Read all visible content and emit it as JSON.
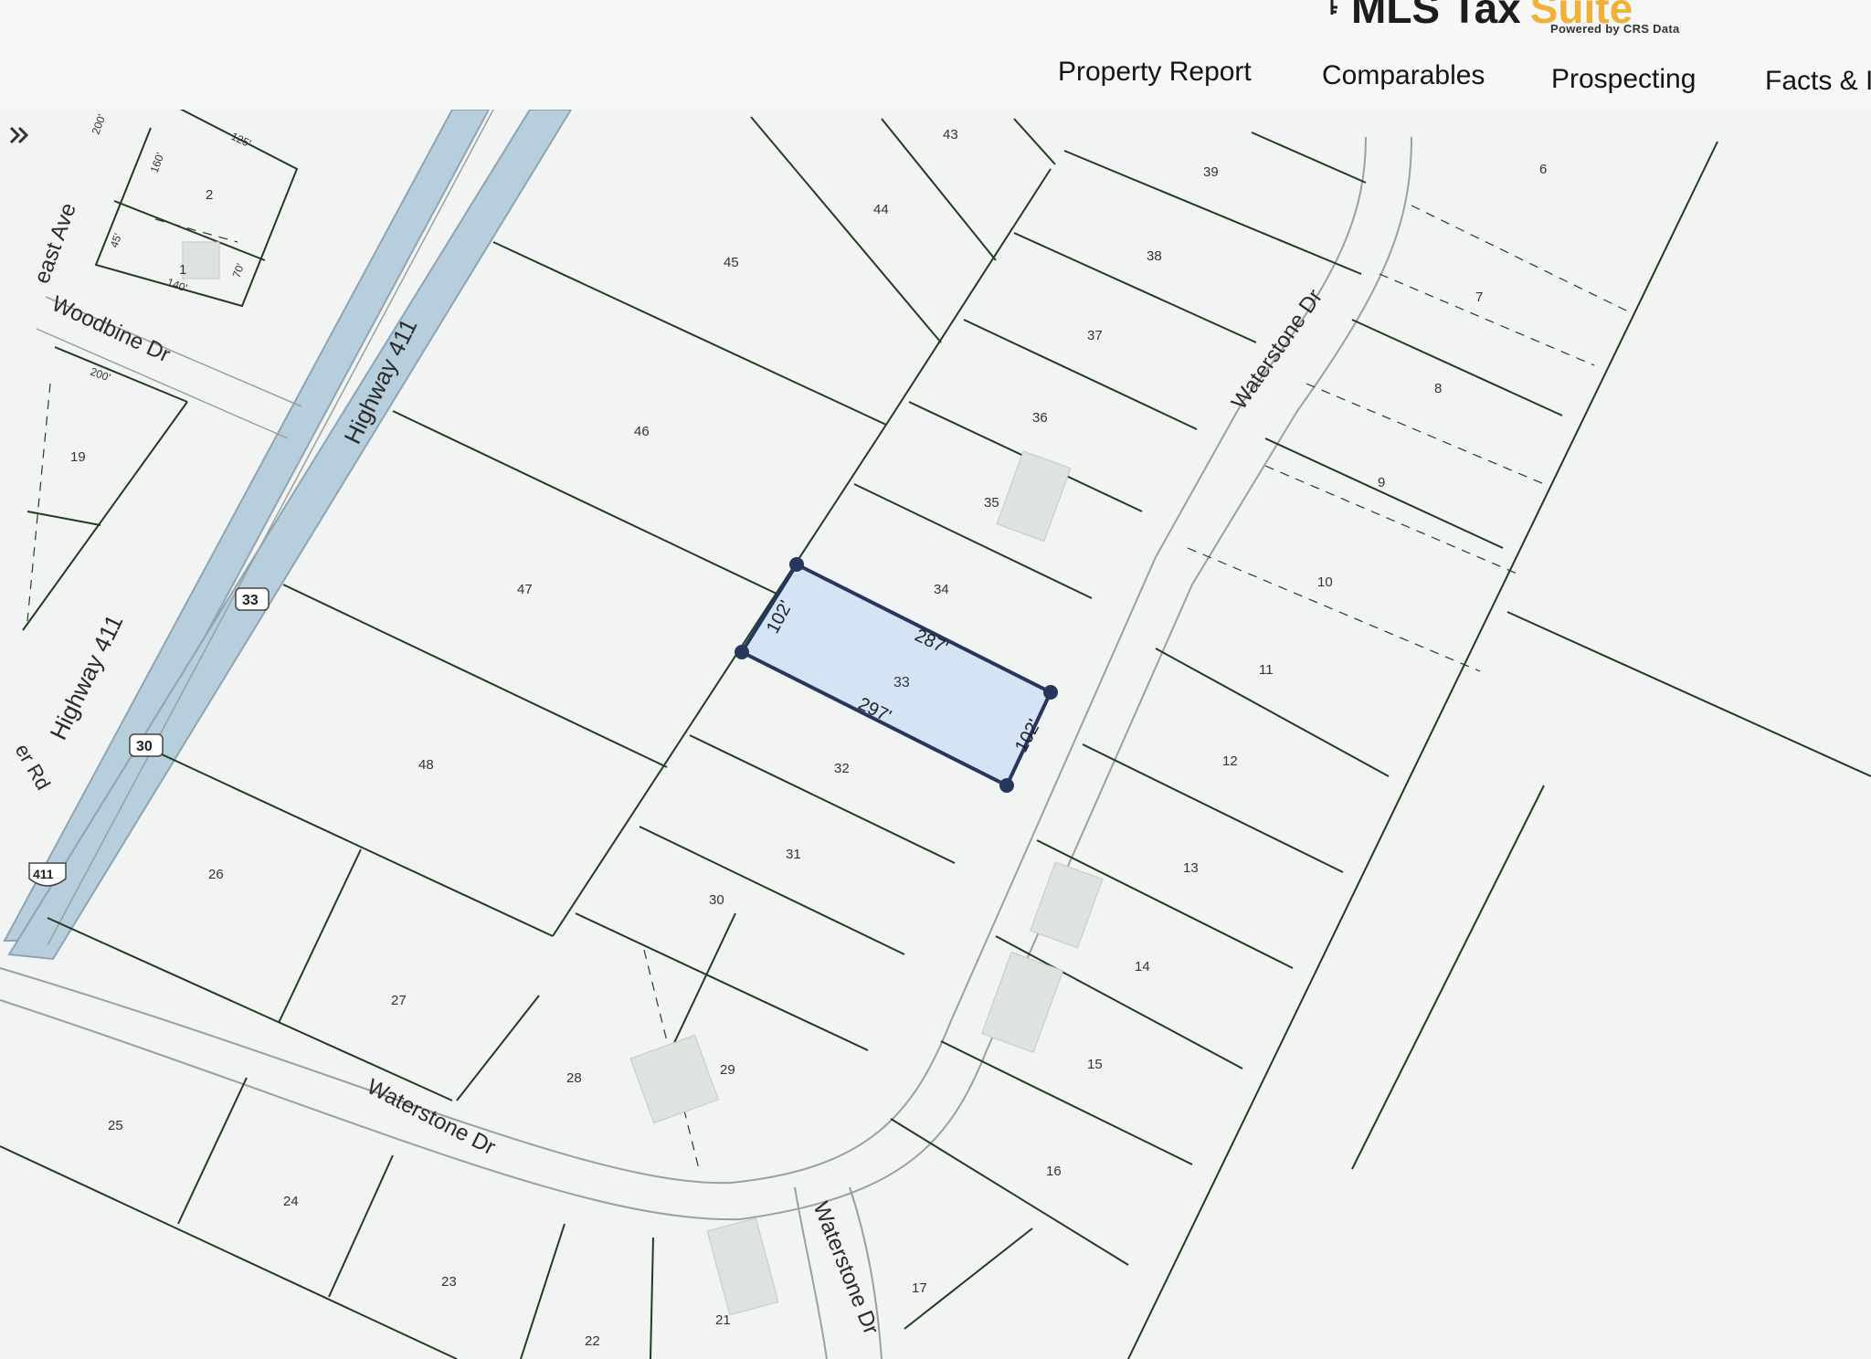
{
  "header": {
    "brand_main": "MLS Tax",
    "brand_accent": "Suite",
    "powered_by": "Powered by CRS Data"
  },
  "nav": {
    "tabs": [
      {
        "label": "Property Report"
      },
      {
        "label": "Comparables"
      },
      {
        "label": "Prospecting"
      },
      {
        "label": "Facts & I"
      }
    ]
  },
  "map": {
    "colors": {
      "lot_line": "#1f3d1f",
      "road_edge": "#9aa19a",
      "highway_fill": "#b7cfdc",
      "selected_fill": "#cfe1f6",
      "selected_stroke": "#27365c",
      "background": "#f1f4f2"
    },
    "streets": {
      "east_ave": "east Ave",
      "woodbine": "Woodbine Dr",
      "highway_upper": "Highway 411",
      "highway_lower": "Highway 411",
      "waterstone_north": "Waterstone Dr",
      "waterstone_west": "Waterstone Dr",
      "waterstone_south": "Waterstone Dr",
      "partial_rd": "er Rd"
    },
    "route_shields": {
      "shield_33": "33",
      "shield_30": "30",
      "shield_411": "411"
    },
    "selected_parcel": {
      "lot": "33",
      "dim_north": "287'",
      "dim_south": "297'",
      "dim_west": "102'",
      "dim_east": "102'"
    },
    "lots": {
      "l1": "1",
      "l2": "2",
      "l6": "6",
      "l7": "7",
      "l8": "8",
      "l9": "9",
      "l10": "10",
      "l11": "11",
      "l12": "12",
      "l13": "13",
      "l14": "14",
      "l15": "15",
      "l16": "16",
      "l17": "17",
      "l19": "19",
      "l21": "21",
      "l22": "22",
      "l23": "23",
      "l24": "24",
      "l25": "25",
      "l26": "26",
      "l27": "27",
      "l28": "28",
      "l29": "29",
      "l30": "30",
      "l31": "31",
      "l32": "32",
      "l34": "34",
      "l35": "35",
      "l36": "36",
      "l37": "37",
      "l38": "38",
      "l39": "39",
      "l43": "43",
      "l44": "44",
      "l45": "45",
      "l46": "46",
      "l47": "47",
      "l48": "48"
    },
    "dims_small": {
      "d200a": "200'",
      "d125": "125'",
      "d160": "160'",
      "d45": "45'",
      "d140": "140'",
      "d70": "70'",
      "d200b": "200'"
    }
  }
}
